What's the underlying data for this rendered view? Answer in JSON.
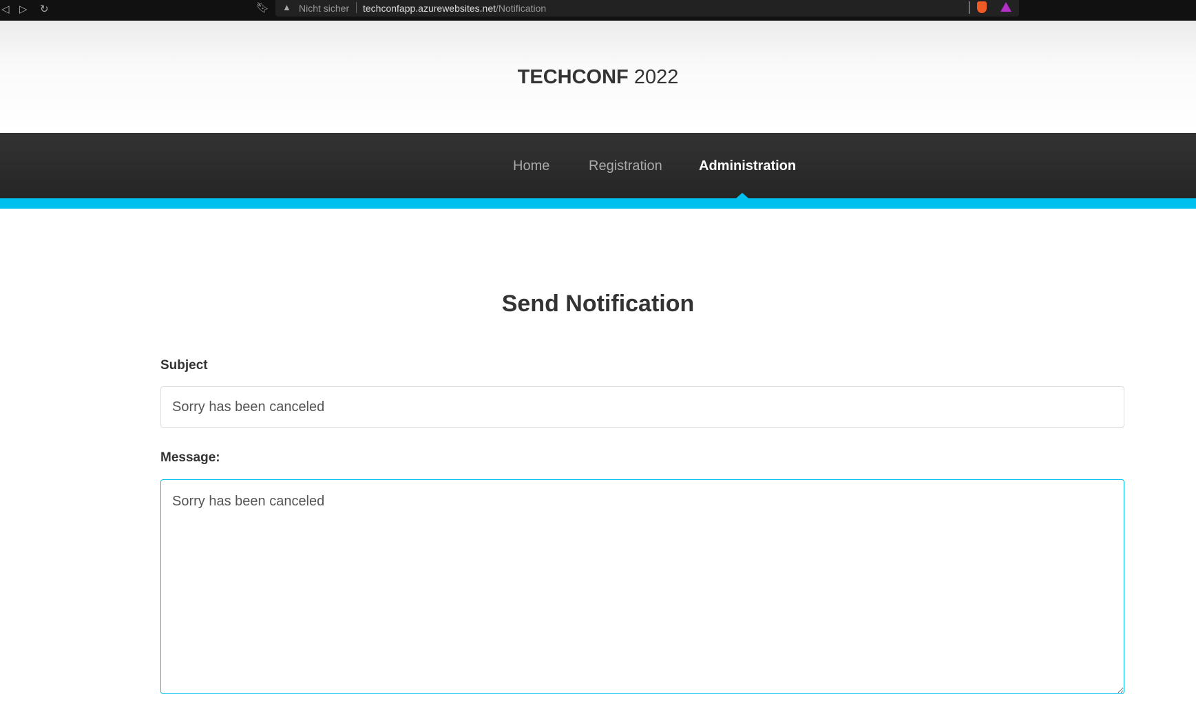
{
  "browser": {
    "security_label": "Nicht sicher",
    "url_host": "techconfapp.azurewebsites.net",
    "url_path": "/Notification"
  },
  "header": {
    "title_bold": "TECHCONF",
    "title_year": "2022"
  },
  "nav": {
    "items": [
      {
        "label": "Home",
        "active": false
      },
      {
        "label": "Registration",
        "active": false
      },
      {
        "label": "Administration",
        "active": true
      }
    ]
  },
  "main": {
    "heading": "Send Notification",
    "subject_label": "Subject",
    "subject_value": "Sorry has been canceled",
    "message_label": "Message:",
    "message_value": "Sorry has been canceled"
  },
  "colors": {
    "accent": "#00c0ef",
    "nav_bg": "#2b2b2b"
  }
}
